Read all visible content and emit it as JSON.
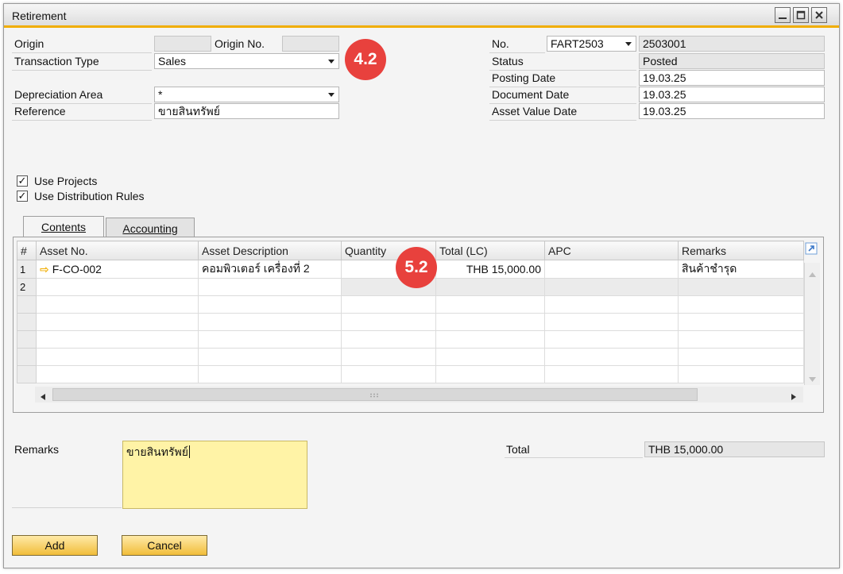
{
  "window": {
    "title": "Retirement",
    "controls": [
      "minimize",
      "maximize",
      "close"
    ]
  },
  "colors": {
    "accent": "#f0ad00",
    "badge": "#e8413d",
    "remarks_bg": "#fff3a6",
    "button_bg": "#f1bd3a"
  },
  "header_left": {
    "origin_label": "Origin",
    "origin_value": "",
    "origin_no_label": "Origin No.",
    "origin_no_value": "",
    "transaction_type_label": "Transaction Type",
    "transaction_type_value": "Sales",
    "depreciation_area_label": "Depreciation Area",
    "depreciation_area_value": "*",
    "reference_label": "Reference",
    "reference_value": "ขายสินทรัพย์"
  },
  "header_right": {
    "no_label": "No.",
    "series_value": "FART2503",
    "doc_number": "2503001",
    "status_label": "Status",
    "status_value": "Posted",
    "posting_date_label": "Posting Date",
    "posting_date_value": "19.03.25",
    "document_date_label": "Document Date",
    "document_date_value": "19.03.25",
    "asset_value_date_label": "Asset Value Date",
    "asset_value_date_value": "19.03.25"
  },
  "badges": {
    "badge_1": "4.2",
    "badge_2": "5.2"
  },
  "checkboxes": {
    "use_projects": "Use Projects",
    "use_distribution_rules": "Use Distribution Rules"
  },
  "tabs": {
    "contents": "Contents",
    "accounting": "Accounting"
  },
  "grid": {
    "columns": [
      "#",
      "Asset No.",
      "Asset Description",
      "Quantity",
      "Total (LC)",
      "APC",
      "Remarks"
    ],
    "rows": [
      {
        "no": "1",
        "asset_no": "F-CO-002",
        "description": "คอมพิวเตอร์ เครื่องที่ 2",
        "quantity": "",
        "total": "THB 15,000.00",
        "apc": "",
        "remarks": "สินค้าชำรุด"
      },
      {
        "no": "2",
        "asset_no": "",
        "description": "",
        "quantity": "",
        "total": "",
        "apc": "",
        "remarks": ""
      }
    ]
  },
  "footer": {
    "remarks_label": "Remarks",
    "remarks_value": "ขายสินทรัพย์",
    "total_label": "Total",
    "total_value": "THB 15,000.00"
  },
  "buttons": {
    "add": "Add",
    "cancel": "Cancel"
  }
}
